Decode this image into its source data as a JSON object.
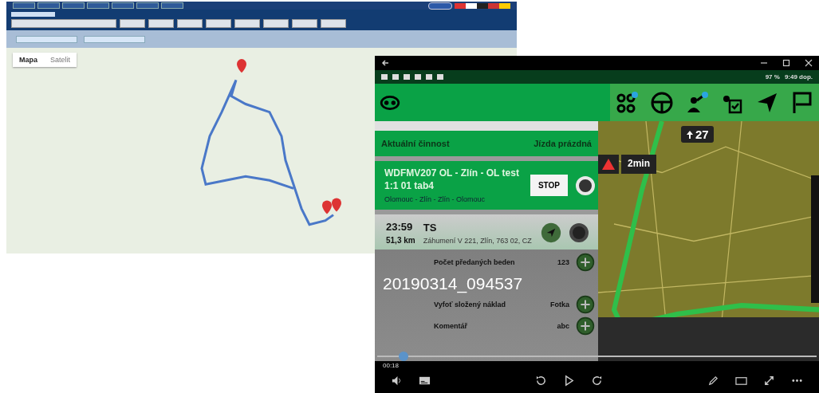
{
  "web_app": {
    "map_tabs": [
      {
        "label": "Mapa",
        "selected": true
      },
      {
        "label": "Satelit",
        "selected": false
      }
    ]
  },
  "android_app": {
    "status_bar": {
      "battery": "97 %",
      "time": "9:49 dop."
    },
    "activity": {
      "label": "Aktuální činnost",
      "value": "Jízda prázdná"
    },
    "trip": {
      "title": "WDFMV207 OL - Zlín - OL test 1:1 01 tab4",
      "route": "Olomouc - Zlín - Zlín - Olomouc",
      "stop_button": "STOP"
    },
    "stop": {
      "time": "23:59",
      "distance": "51,3 km",
      "name": "TS",
      "address": "Záhumení V 221, Zlín, 763 02, CZ"
    },
    "tasks": [
      {
        "label": "Počet předaných beden",
        "value": "123"
      },
      {
        "label": "Vyfoť složený náklad",
        "value": "Fotka"
      },
      {
        "label": "Komentář",
        "value": "abc"
      }
    ],
    "navigation": {
      "speed": "27",
      "eta": "2min"
    }
  },
  "video_player": {
    "title": "20190314_094537",
    "elapsed": "00:18",
    "level": 0.06
  }
}
